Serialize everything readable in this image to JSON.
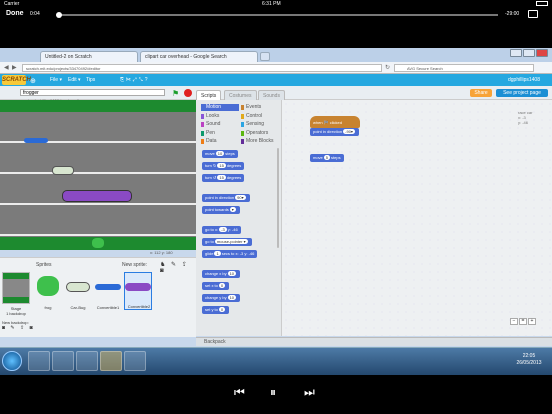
{
  "ios": {
    "carrier": "Carrier",
    "time": "6:31 PM"
  },
  "video": {
    "done_label": "Done",
    "elapsed": "0:04",
    "remaining": "-29:00",
    "progress": 0.005
  },
  "browser": {
    "tabs": [
      "Untitled-2 on Scratch",
      "clipart car overhead - Google Search"
    ],
    "url": "scratch.mit.edu/projects/33470492/#editor",
    "search_placeholder": "AVG Secure Search"
  },
  "scratch": {
    "logo": "SCRATCH",
    "menu": [
      "File ▾",
      "Edit ▾",
      "Tips"
    ],
    "username": "dgphillips1408",
    "project_title": "frogger",
    "owner": "by dgphillips1408 (unshared)",
    "editor_tabs": [
      "Scripts",
      "Costumes",
      "Sounds"
    ],
    "share_label": "Share",
    "see_project_label": "See project page",
    "stage_info": "x: 112  y: 180"
  },
  "categories": [
    {
      "label": "Motion",
      "color": "#4a6cd4"
    },
    {
      "label": "Events",
      "color": "#c88330"
    },
    {
      "label": "Looks",
      "color": "#8a55d7"
    },
    {
      "label": "Control",
      "color": "#e1a91a"
    },
    {
      "label": "Sound",
      "color": "#bb42c3"
    },
    {
      "label": "Sensing",
      "color": "#2ca5e2"
    },
    {
      "label": "Pen",
      "color": "#0e9a6c"
    },
    {
      "label": "Operators",
      "color": "#5cb712"
    },
    {
      "label": "Data",
      "color": "#ee7d16"
    },
    {
      "label": "More Blocks",
      "color": "#632d99"
    }
  ],
  "palette_blocks": [
    {
      "text": "move",
      "arg": "10",
      "tail": "steps"
    },
    {
      "text": "turn ↻",
      "arg": "15",
      "tail": "degrees"
    },
    {
      "text": "turn ↺",
      "arg": "15",
      "tail": "degrees"
    },
    {
      "text": "point in direction",
      "arg": "90▾",
      "tail": ""
    },
    {
      "text": "point towards",
      "arg": "▾",
      "tail": ""
    },
    {
      "text": "go to x:",
      "arg": "-3",
      "tail": "y: -46"
    },
    {
      "text": "go to",
      "arg": "mouse-pointer ▾",
      "tail": ""
    },
    {
      "text": "glide",
      "arg": "1",
      "tail": "secs to x: -3 y: -46"
    },
    {
      "text": "change x by",
      "arg": "10",
      "tail": ""
    },
    {
      "text": "set x to",
      "arg": "0",
      "tail": ""
    },
    {
      "text": "change y by",
      "arg": "10",
      "tail": ""
    },
    {
      "text": "set y to",
      "arg": "0",
      "tail": ""
    }
  ],
  "script": {
    "hat": "when 🏁 clicked",
    "point": "point in direction",
    "point_arg": "-90▾",
    "move": "move",
    "move_arg": "5",
    "move_tail": "steps"
  },
  "coord_readout": {
    "name": "race car",
    "x": "x: -3",
    "y": "y: -46"
  },
  "sprites": {
    "label": "Sprites",
    "new_sprite": "New sprite:",
    "stage_label": "Stage",
    "stage_backdrops": "1 backdrop",
    "new_backdrop": "New backdrop:",
    "items": [
      "frog",
      "Car-Bug",
      "Convertible1",
      "Convertible2"
    ]
  },
  "backpack": "Backpack",
  "taskbar": {
    "time": "22:05",
    "date": "26/05/2013"
  }
}
